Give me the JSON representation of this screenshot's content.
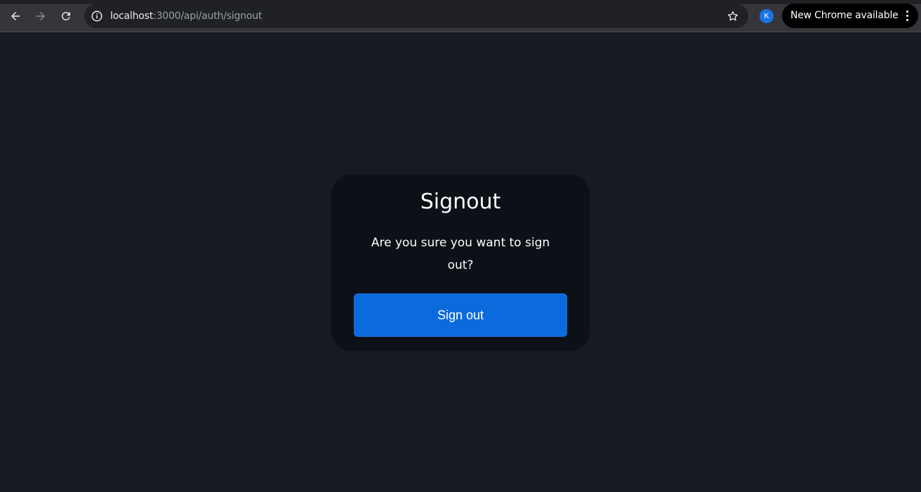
{
  "browser": {
    "url_host": "localhost",
    "url_path": ":3000/api/auth/signout",
    "profile_initial": "K",
    "update_chip_label": "New Chrome available",
    "icons": [
      "back-icon",
      "forward-icon",
      "reload-icon",
      "site-info-icon",
      "bookmark-star-icon",
      "more-vert-icon"
    ]
  },
  "page": {
    "title": "Signout",
    "message": "Are you sure you want to sign out?",
    "button_label": "Sign out"
  },
  "colors": {
    "page_background": "#171a22",
    "card_background": "#0d1017",
    "button_background": "#0c6bdc",
    "toolbar_background": "#35363a"
  }
}
